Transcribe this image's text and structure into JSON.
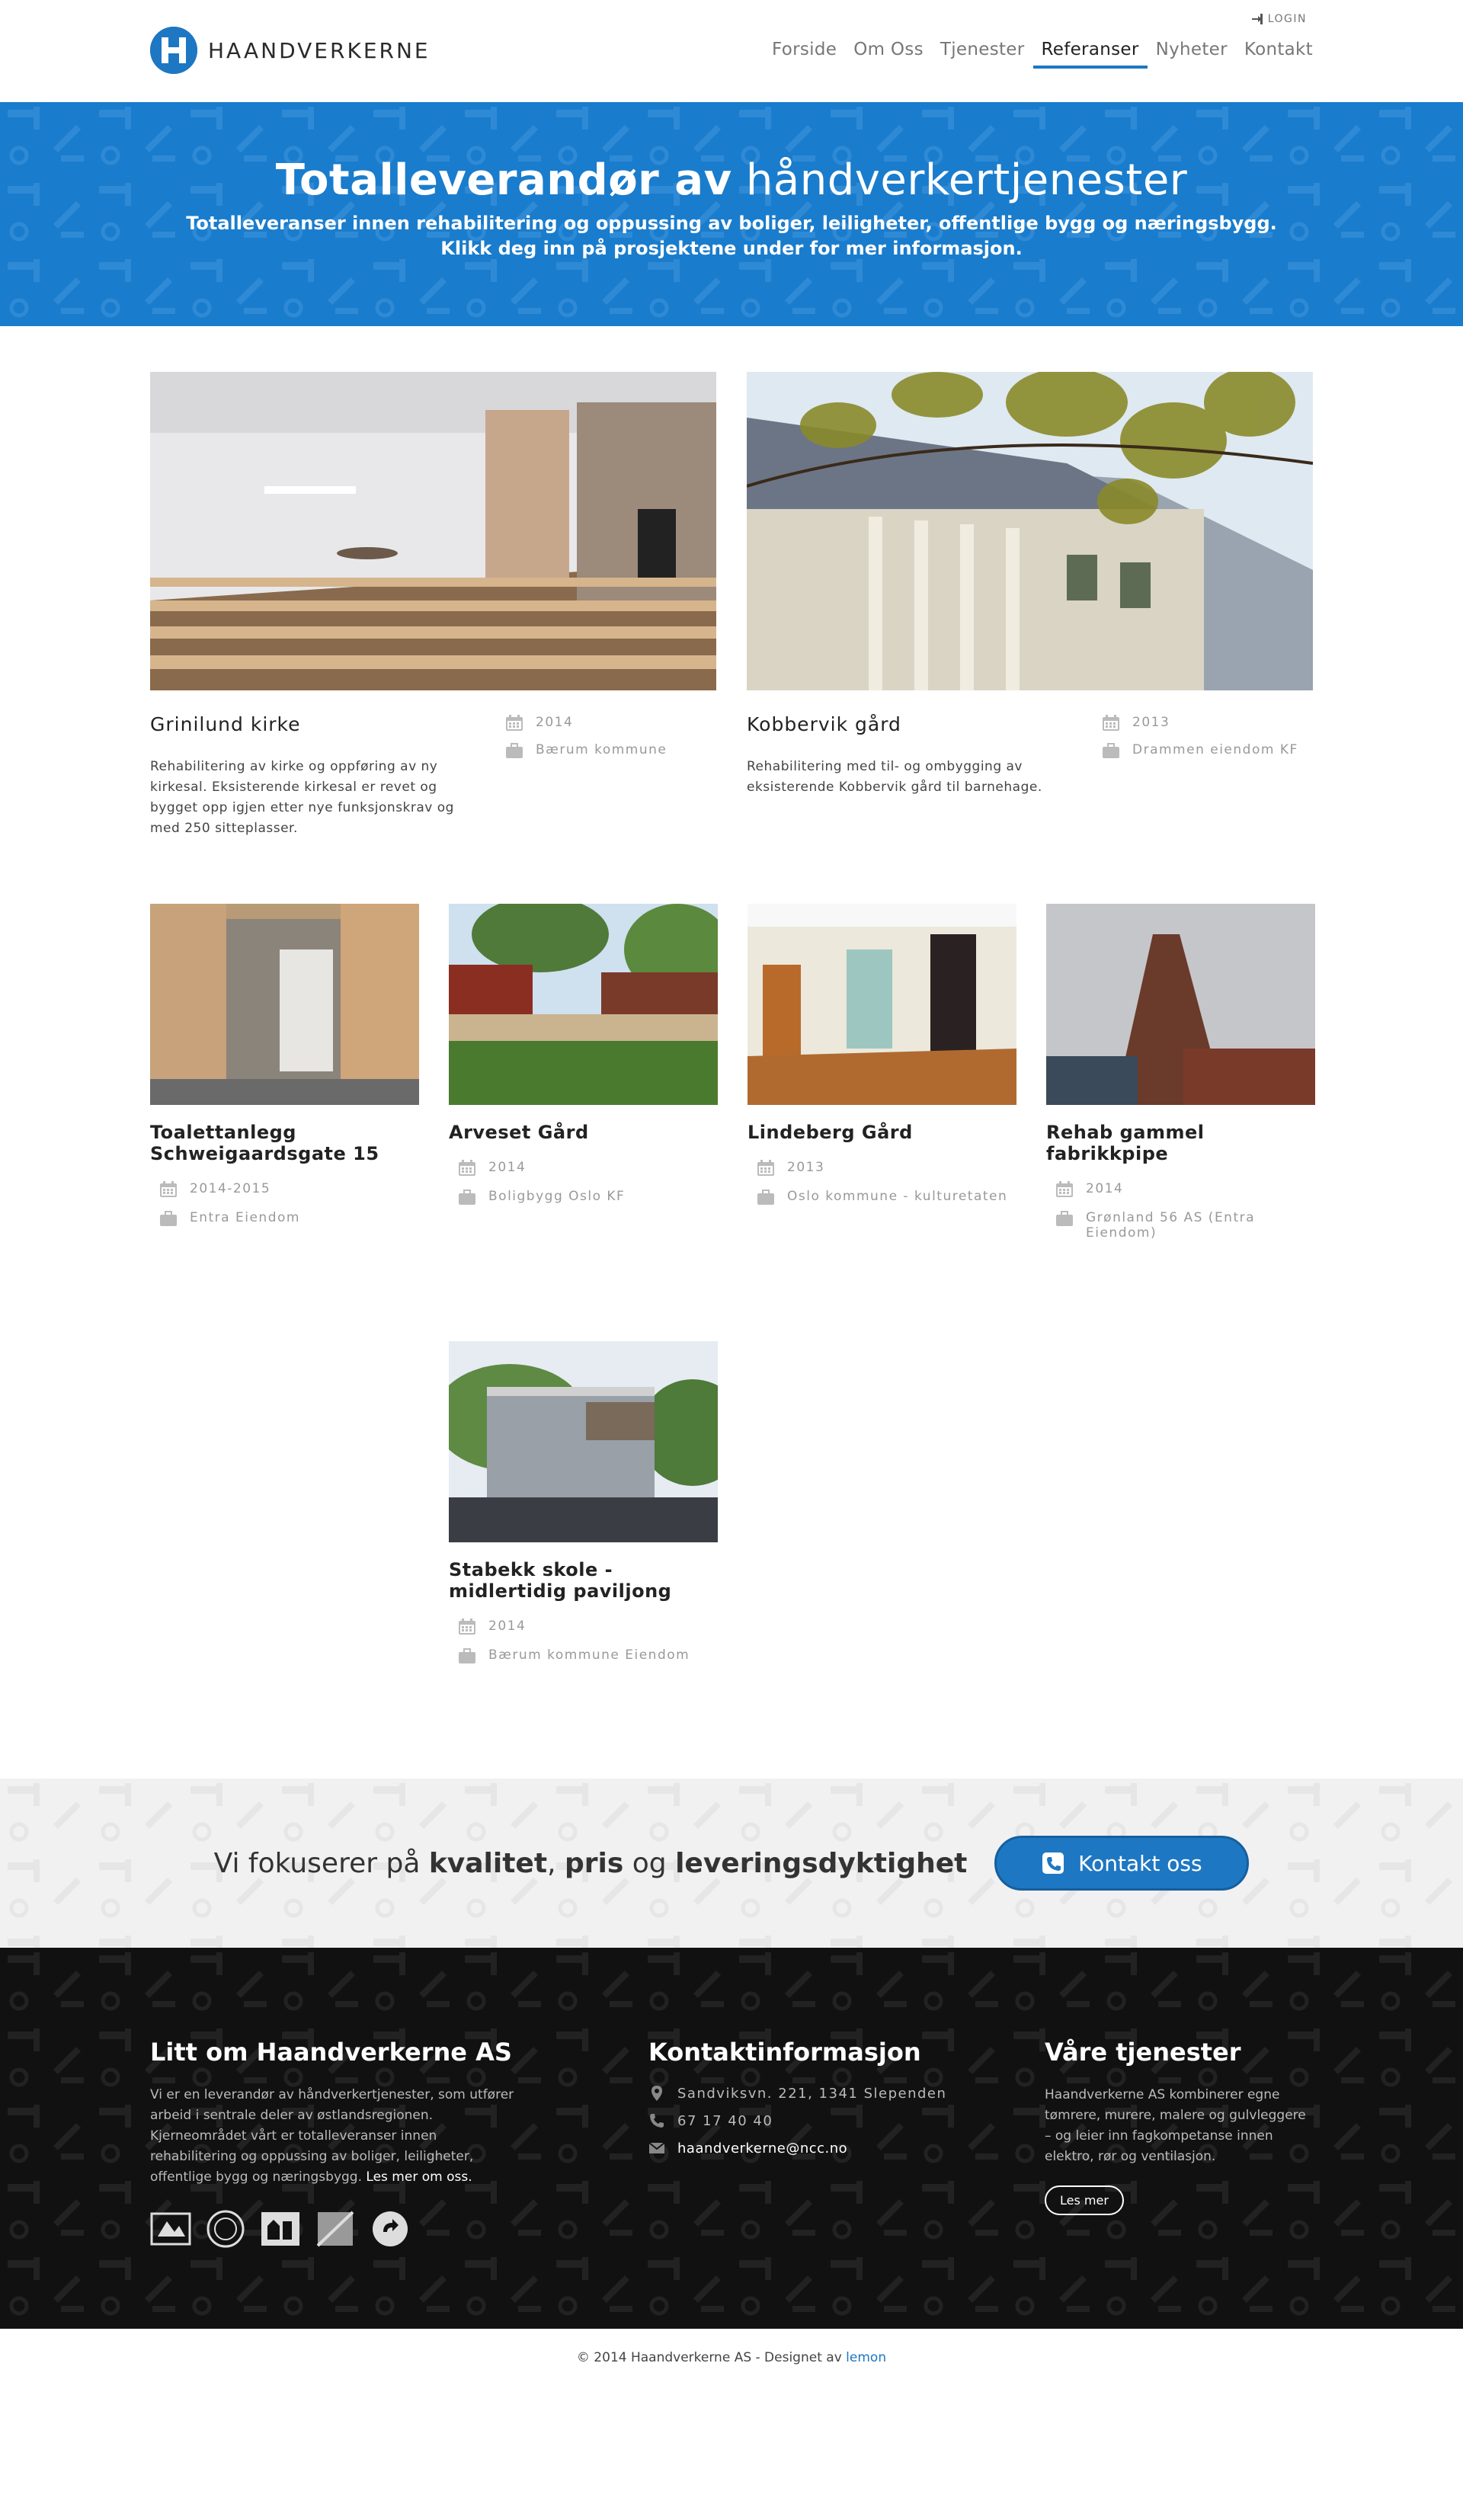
{
  "header": {
    "logo_text": "HAANDVERKERNE",
    "login_label": "LOGIN",
    "nav": [
      {
        "label": "Forside"
      },
      {
        "label": "Om Oss"
      },
      {
        "label": "Tjenester"
      },
      {
        "label": "Referanser"
      },
      {
        "label": "Nyheter"
      },
      {
        "label": "Kontakt"
      }
    ],
    "active_nav": "Referanser"
  },
  "hero": {
    "title_bold": "Totalleverandør av",
    "title_rest": "håndverkertjenester",
    "subtitle_line1": "Totalleveranser innen rehabilitering og oppussing av boliger, leiligheter, offentlige bygg og næringsbygg.",
    "subtitle_line2": "Klikk deg inn på prosjektene under for mer informasjon."
  },
  "large_references": [
    {
      "title": "Grinilund kirke",
      "description": "Rehabilitering av kirke og oppføring av ny kirkesal. Eksisterende kirkesal er revet og bygget opp igjen etter nye funksjonskrav og med 250 sitteplasser.",
      "year": "2014",
      "client": "Bærum kommune"
    },
    {
      "title": "Kobbervik gård",
      "description": "Rehabilitering med til- og ombygging av eksisterende Kobbervik gård til barnehage.",
      "year": "2013",
      "client": "Drammen eiendom KF"
    }
  ],
  "small_references": [
    {
      "title": "Toalettanlegg Schweigaardsgate 15",
      "year": "2014-2015",
      "client": "Entra Eiendom"
    },
    {
      "title": "Arveset Gård",
      "year": "2014",
      "client": "Boligbygg Oslo KF"
    },
    {
      "title": "Lindeberg Gård",
      "year": "2013",
      "client": "Oslo kommune - kulturetaten"
    },
    {
      "title": "Rehab gammel fabrikkpipe",
      "year": "2014",
      "client": "Grønland 56 AS (Entra Eiendom)"
    },
    {
      "title": "Stabekk skole - midlertidig paviljong",
      "year": "2014",
      "client": "Bærum kommune Eiendom"
    }
  ],
  "cta": {
    "text_prefix": "Vi fokuserer på",
    "word1": "kvalitet",
    "sep1": ",",
    "word2": "pris",
    "sep2": "og",
    "word3": "leveringsdyktighet",
    "button_label": "Kontakt oss"
  },
  "footer": {
    "about_title": "Litt om Haandverkerne AS",
    "about_text": "Vi er en leverandør av håndverkertjenester, som utfører arbeid i sentrale deler av østlandsregionen. Kjerneområdet vårt er totalleveranser innen rehabilitering og oppussing av boliger, leiligheter, offentlige bygg og næringsbygg.",
    "about_link": "Les mer om oss.",
    "contact_title": "Kontaktinformasjon",
    "address": "Sandviksvn. 221, 1341 Slependen",
    "phone": "67 17 40 40",
    "email": "haandverkerne@ncc.no",
    "services_title": "Våre tjenester",
    "services_text": "Haandverkerne AS kombinerer egne tømrere, murere, malere og gulvleggere – og leier inn fagkompetanse innen elektro, rør og ventilasjon.",
    "services_button": "Les mer"
  },
  "copyright": {
    "text": "© 2014 Haandverkerne AS - Designet av",
    "link": "lemon"
  },
  "colors": {
    "brand_blue": "#1e77c2",
    "hero_blue": "#1a7ccc",
    "footer_bg": "#111111",
    "cta_bg": "#f1f1f1"
  }
}
